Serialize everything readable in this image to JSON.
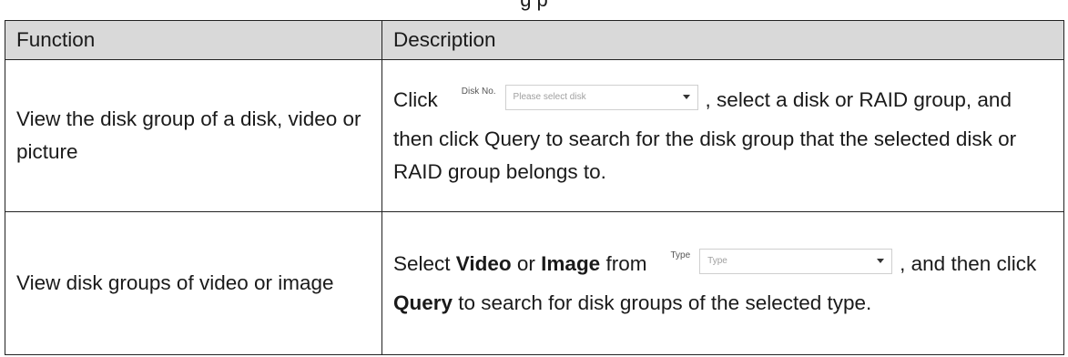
{
  "caption_partial": "g p",
  "table": {
    "headers": {
      "function": "Function",
      "description": "Description"
    },
    "rows": [
      {
        "function": "View the disk group of a disk, video or picture",
        "desc_prefix": "Click",
        "widget": {
          "label": "Disk No.",
          "placeholder": "Please select disk",
          "icon": "chevron-down-icon"
        },
        "desc_suffix": ", select a disk or RAID group, and then click Query to search for the disk group that the selected disk or RAID group belongs to."
      },
      {
        "function": "View disk groups of video or image",
        "desc_part1": "Select ",
        "desc_bold1": "Video",
        "desc_part2": " or ",
        "desc_bold2": "Image",
        "desc_part3": " from",
        "widget": {
          "label": "Type",
          "placeholder": "Type",
          "icon": "chevron-down-icon"
        },
        "desc_part4": ", and then click ",
        "desc_bold3": "Query",
        "desc_part5": " to search for disk groups of the selected type."
      }
    ]
  },
  "colors": {
    "header_bg": "#d9d9d9",
    "border": "#222222",
    "text": "#1a1a1a"
  }
}
